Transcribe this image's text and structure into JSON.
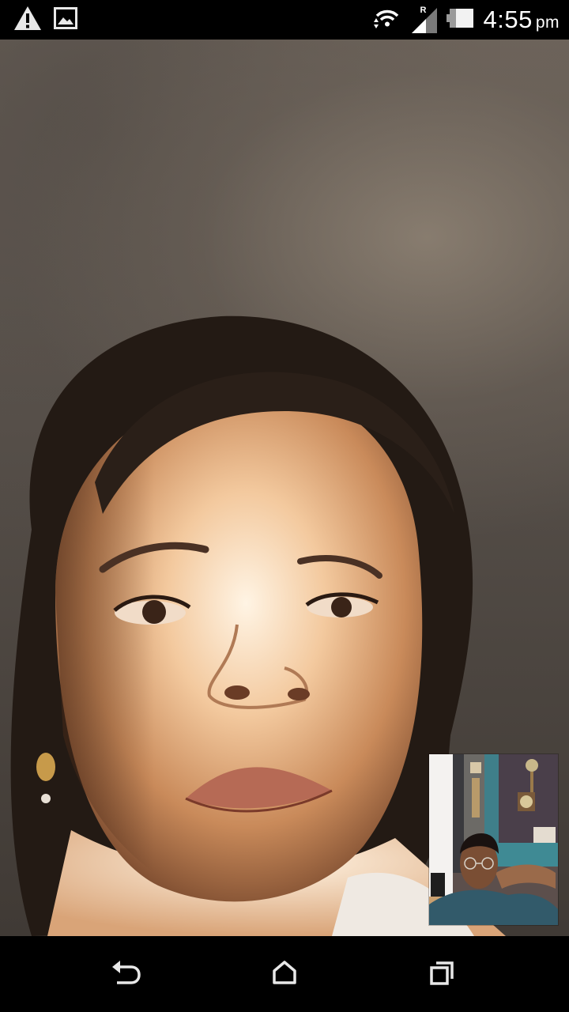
{
  "status_bar": {
    "time": "4:55",
    "time_suffix": "pm",
    "roaming_indicator": "R",
    "left_icons": [
      "warning-icon",
      "image-icon"
    ],
    "right_icons": [
      "wifi-data-icon",
      "cell-signal-icon",
      "battery-icon"
    ]
  },
  "call": {
    "remote_video": "remote-participant-video",
    "self_view": "local-camera-preview"
  },
  "nav_bar": {
    "buttons": [
      "back-icon",
      "home-icon",
      "recents-icon"
    ]
  },
  "colors": {
    "system_bar": "#000000",
    "status_icon": "#ffffff",
    "nav_icon": "#e8e8e8"
  }
}
